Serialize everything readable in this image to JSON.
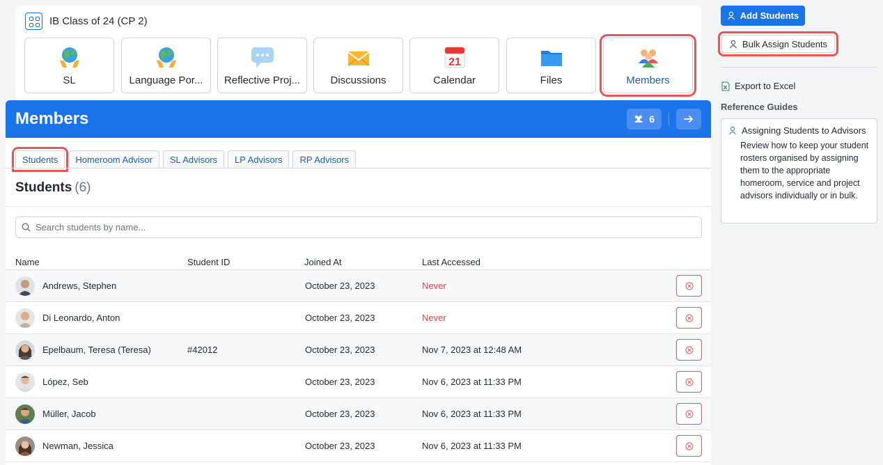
{
  "class_panel": {
    "title": "IB Class of 24 (CP 2)",
    "tiles": [
      {
        "label": "SL",
        "icon": "globe-hands-icon"
      },
      {
        "label": "Language Por...",
        "icon": "globe-hands-icon"
      },
      {
        "label": "Reflective Proj...",
        "icon": "speech-bubble-icon"
      },
      {
        "label": "Discussions",
        "icon": "envelope-icon"
      },
      {
        "label": "Calendar",
        "icon": "calendar-icon",
        "day": "21"
      },
      {
        "label": "Files",
        "icon": "folder-icon"
      },
      {
        "label": "Members",
        "icon": "people-group-icon"
      }
    ]
  },
  "members": {
    "title": "Members",
    "count": "6",
    "tabs": [
      "Students",
      "Homeroom Advisor",
      "SL Advisors",
      "LP Advisors",
      "RP Advisors"
    ],
    "section_title": "Students",
    "section_count": "(6)",
    "search_placeholder": "Search students by name...",
    "columns": [
      "Name",
      "Student ID",
      "Joined At",
      "Last Accessed"
    ],
    "rows": [
      {
        "name": "Andrews, Stephen",
        "student_id": "",
        "joined": "October 23, 2023",
        "last": "Never"
      },
      {
        "name": "Di Leonardo, Anton",
        "student_id": "",
        "joined": "October 23, 2023",
        "last": "Never"
      },
      {
        "name": "Epelbaum, Teresa (Teresa)",
        "student_id": "#42012",
        "joined": "October 23, 2023",
        "last": "Nov 7, 2023 at 12:48 AM"
      },
      {
        "name": "López, Seb",
        "student_id": "",
        "joined": "October 23, 2023",
        "last": "Nov 6, 2023 at 11:33 PM"
      },
      {
        "name": "Müller, Jacob",
        "student_id": "",
        "joined": "October 23, 2023",
        "last": "Nov 6, 2023 at 11:33 PM"
      },
      {
        "name": "Newman, Jessica",
        "student_id": "",
        "joined": "October 23, 2023",
        "last": "Nov 6, 2023 at 11:33 PM"
      }
    ]
  },
  "sidebar": {
    "add_students": "Add Students",
    "bulk_assign": "Bulk Assign Students",
    "export": "Export to Excel",
    "reference_title": "Reference Guides",
    "guide_title": "Assigning Students to Advisors",
    "guide_body": "Review how to keep your student rosters organised by assigning them to the appropriate homeroom, service and project advisors individually or in bulk."
  },
  "colors": {
    "primary": "#1a73e8",
    "highlight": "#e45757",
    "never": "#d64545"
  }
}
